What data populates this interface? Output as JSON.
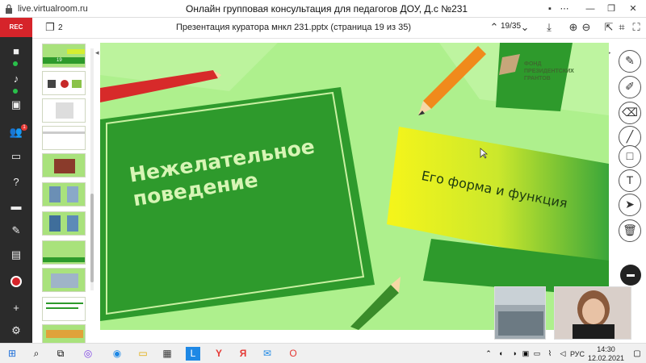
{
  "browser": {
    "url": "live.virtualroom.ru",
    "title": "Онлайн групповая консультация для педагогов ДОУ, Д.с №231"
  },
  "left_sidebar": {
    "rec_label": "REC",
    "chat_badge": "1"
  },
  "presentation_toolbar": {
    "layers_count": "2",
    "file_title": "Презентация куратора мнкл 231.pptx (страница 19 из 35)",
    "page_indicator": "19/35"
  },
  "slide": {
    "main_title_line1": "Нежелательное",
    "main_title_line2": "поведение",
    "subtitle": "Его форма и функция",
    "logo_line1": "ФОНД",
    "logo_line2": "ПРЕЗИДЕНТСКИХ",
    "logo_line3": "ГРАНТОВ",
    "colors": {
      "background": "#aef08d",
      "dark_green": "#2e9a2c",
      "yellow": "#e6f62c",
      "pencil_red": "#d72a2a",
      "pencil_orange": "#f08a1c"
    }
  },
  "thumbnail_page_marker": "19",
  "taskbar": {
    "time": "14:30",
    "date": "12.02.2021",
    "language": "РУС"
  }
}
